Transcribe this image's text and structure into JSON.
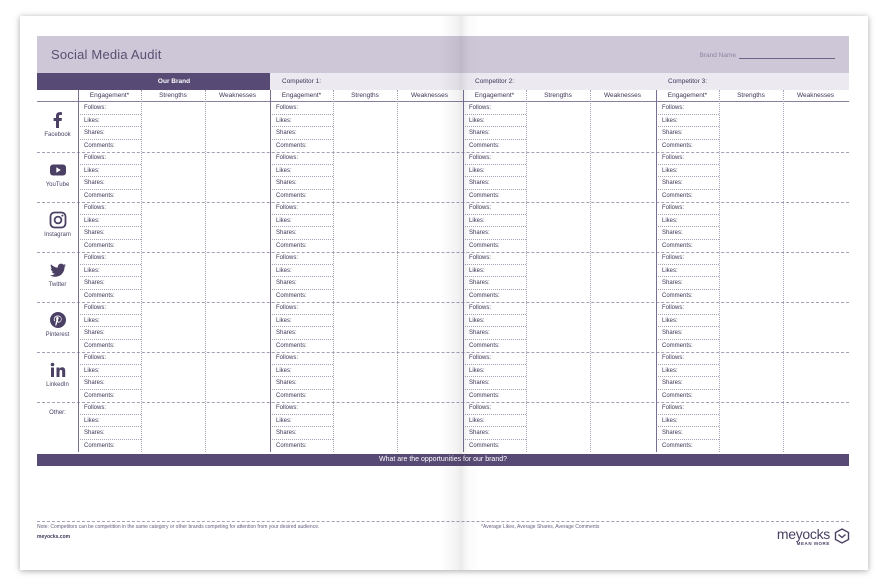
{
  "title": "Social Media Audit",
  "brand_name_label": "Brand Name",
  "groups": [
    "Our Brand",
    "Competitor 1:",
    "Competitor 2:",
    "Competitor 3:"
  ],
  "subheaders": [
    "Engagement*",
    "Strengths",
    "Weaknesses"
  ],
  "metrics": [
    "Follows:",
    "Likes:",
    "Shares:",
    "Comments:"
  ],
  "platforms": [
    {
      "label": "Facebook",
      "icon": "facebook-icon"
    },
    {
      "label": "YouTube",
      "icon": "youtube-icon"
    },
    {
      "label": "Instagram",
      "icon": "instagram-icon"
    },
    {
      "label": "Twitter",
      "icon": "twitter-icon"
    },
    {
      "label": "Pinterest",
      "icon": "pinterest-icon"
    },
    {
      "label": "LinkedIn",
      "icon": "linkedin-icon"
    },
    {
      "label": "Other:",
      "icon": ""
    }
  ],
  "opportunities": "What are the opportunities for our brand?",
  "note": "Note: Competitors can be competition in the same category or other brands competing for attention from your desired audience.",
  "footnote": "*Average Likes, Average Shares, Average Comments",
  "url": "meyocks.com",
  "logo": {
    "name": "meyocks",
    "tagline": "MEAN MORE"
  },
  "colors": {
    "primary": "#574a74",
    "band": "#cdc7d8",
    "light": "#ece9f1"
  }
}
